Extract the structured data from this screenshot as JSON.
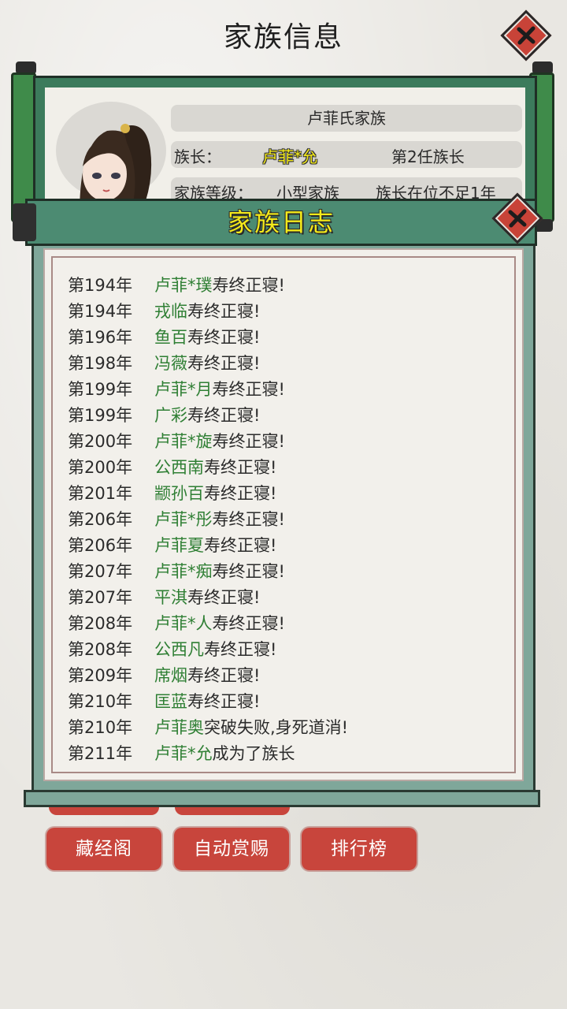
{
  "header": {
    "title": "家族信息"
  },
  "family_info": {
    "family_name": "卢菲氏家族",
    "leader_label": "族长：",
    "leader_name": "卢菲*允",
    "leader_generation": "第2任族长",
    "level_label": "家族等级：",
    "level_value": "小型家族",
    "tenure": "族长在位不足1年"
  },
  "log": {
    "title": "家族日志",
    "entries": [
      {
        "year": "第194年",
        "name": "卢菲*璞",
        "event": "寿终正寝!"
      },
      {
        "year": "第194年",
        "name": "戎临",
        "event": "寿终正寝!"
      },
      {
        "year": "第196年",
        "name": "鱼百",
        "event": "寿终正寝!"
      },
      {
        "year": "第198年",
        "name": "冯薇",
        "event": "寿终正寝!"
      },
      {
        "year": "第199年",
        "name": "卢菲*月",
        "event": "寿终正寝!"
      },
      {
        "year": "第199年",
        "name": "广彩",
        "event": "寿终正寝!"
      },
      {
        "year": "第200年",
        "name": "卢菲*旋",
        "event": "寿终正寝!"
      },
      {
        "year": "第200年",
        "name": "公西南",
        "event": "寿终正寝!"
      },
      {
        "year": "第201年",
        "name": "颛孙百",
        "event": "寿终正寝!"
      },
      {
        "year": "第206年",
        "name": "卢菲*彤",
        "event": "寿终正寝!"
      },
      {
        "year": "第206年",
        "name": "卢菲夏",
        "event": "寿终正寝!"
      },
      {
        "year": "第207年",
        "name": "卢菲*痴",
        "event": "寿终正寝!"
      },
      {
        "year": "第207年",
        "name": "平淇",
        "event": "寿终正寝!"
      },
      {
        "year": "第208年",
        "name": "卢菲*人",
        "event": "寿终正寝!"
      },
      {
        "year": "第208年",
        "name": "公西凡",
        "event": "寿终正寝!"
      },
      {
        "year": "第209年",
        "name": "席烟",
        "event": "寿终正寝!"
      },
      {
        "year": "第210年",
        "name": "匡蓝",
        "event": "寿终正寝!"
      },
      {
        "year": "第210年",
        "name": "卢菲奥",
        "event": "突破失败,身死道消!"
      },
      {
        "year": "第211年",
        "name": "卢菲*允",
        "event": "成为了族长"
      }
    ]
  },
  "buttons": {
    "library": "藏经阁",
    "auto_reward": "自动赏赐",
    "ranking": "排行榜"
  },
  "colors": {
    "accent_red": "#c8453c",
    "scroll_green": "#3c7b5c",
    "name_green": "#2f7f34",
    "title_yellow": "#f4ea1a"
  }
}
